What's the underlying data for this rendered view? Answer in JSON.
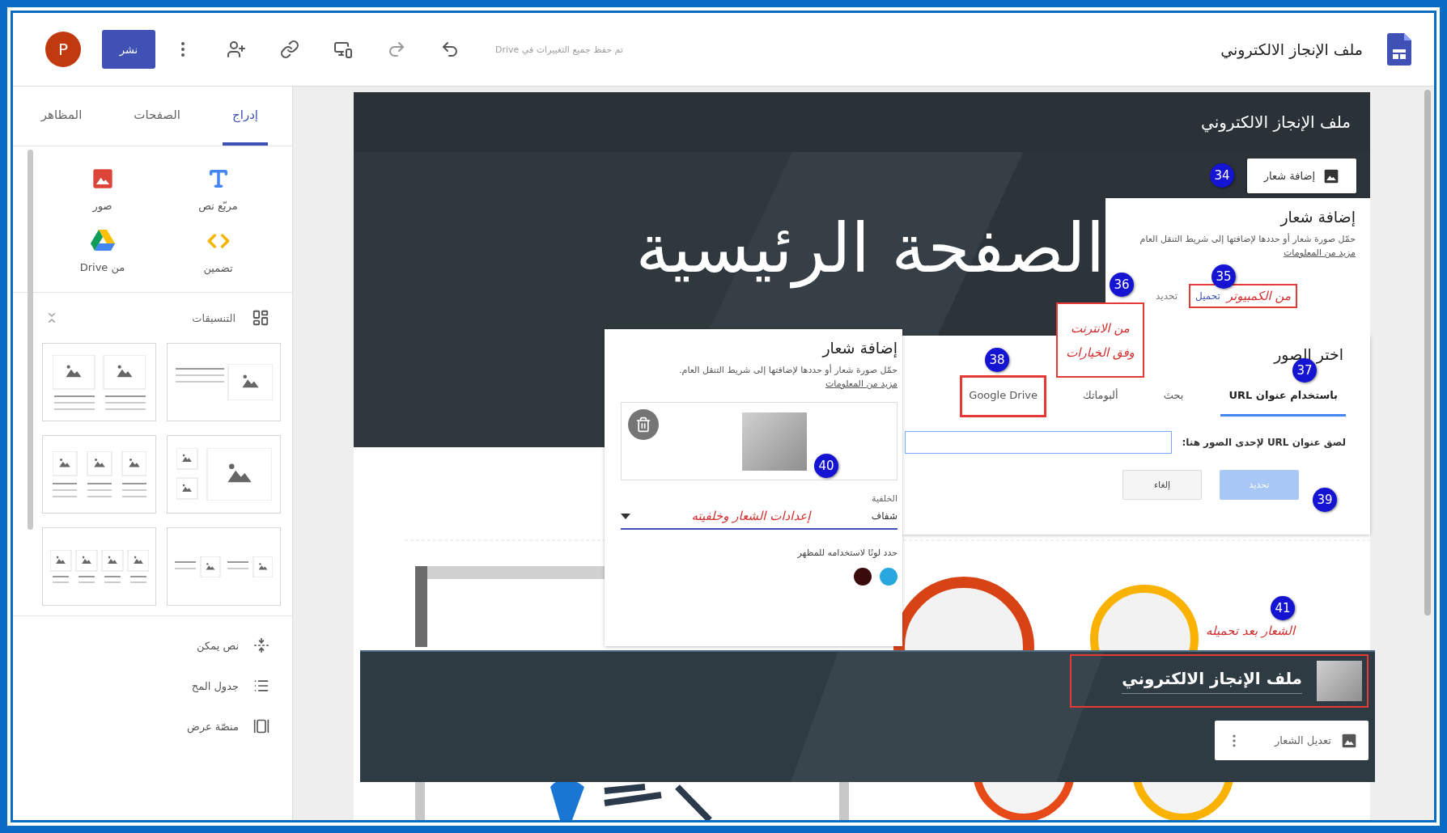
{
  "toolbar": {
    "avatar_letter": "P",
    "publish_button": "نشر",
    "save_status": "تم حفظ جميع التغييرات في Drive",
    "site_title": "ملف الإنجاز الالكتروني"
  },
  "sidebar": {
    "tabs": [
      {
        "label": "إدراج",
        "selected": true
      },
      {
        "label": "الصفحات",
        "selected": false
      },
      {
        "label": "المظاهر",
        "selected": false
      }
    ],
    "insert_items": [
      {
        "kind": "text_box",
        "label": "مربّع نص"
      },
      {
        "kind": "images",
        "label": "صور"
      },
      {
        "kind": "embed",
        "label": "تضمين"
      },
      {
        "kind": "drive",
        "label": "من Drive"
      }
    ],
    "layouts": {
      "title": "التنسيقات",
      "expanded": true
    },
    "components": [
      {
        "kind": "collapsible",
        "label": "نص يمكن"
      },
      {
        "kind": "toc",
        "label": "جدول المح"
      },
      {
        "kind": "carousel",
        "label": "منصّة عرض"
      }
    ]
  },
  "site": {
    "header_title": "ملف الإنجاز الالكتروني",
    "add_logo_button": "إضافة شعار",
    "page_title": "الصفحة الرئيسية"
  },
  "logo_dialog": {
    "title": "إضافة شعار",
    "description": "حمّل صورة شعار أو حددها لإضافتها إلى شريط التنقل العام",
    "more_link": "مزيد من المعلومات",
    "upload_link": "تحميل",
    "select_link": "تحديد"
  },
  "image_picker": {
    "title": "اختر الصور",
    "tabs": [
      {
        "label": "باستخدام عنوان URL",
        "selected": true,
        "highlighted": false
      },
      {
        "label": "بحث",
        "selected": false,
        "highlighted": false
      },
      {
        "label": "ألبوماتك",
        "selected": false,
        "highlighted": false
      },
      {
        "label": "Google Drive",
        "selected": false,
        "highlighted": true
      }
    ],
    "url_label": "لصق عنوان URL لإحدى الصور هنا:",
    "buttons": [
      {
        "label": "تحديد",
        "disabled": true
      },
      {
        "label": "إلغاء",
        "disabled": false
      }
    ]
  },
  "logo_settings": {
    "title": "إضافة شعار",
    "description": "حمّل صورة شعار أو حددها لإضافتها إلى شريط التنقل العام.",
    "more_link": "مزيد من المعلومات",
    "background_label": "الخلفية",
    "background_value": "شفاف",
    "color_prompt": "حدد لونًا لاستخدامه للمظهر",
    "colors": [
      {
        "color": "#29a8e0"
      },
      {
        "color": "#3b0a0a"
      }
    ]
  },
  "result_header": {
    "title": "ملف الإنجاز الالكتروني",
    "highlighted": true,
    "edit_logo_button": "تعديل الشعار"
  },
  "annotations": {
    "badges": [
      "34",
      "35",
      "36",
      "37",
      "38",
      "39",
      "40",
      "41"
    ],
    "notes": [
      "من الكمبيوتر",
      "من الانترنت وفق الخيارات",
      "إعدادات الشعار وخلفيته",
      "الشعار بعد تحميله"
    ]
  }
}
